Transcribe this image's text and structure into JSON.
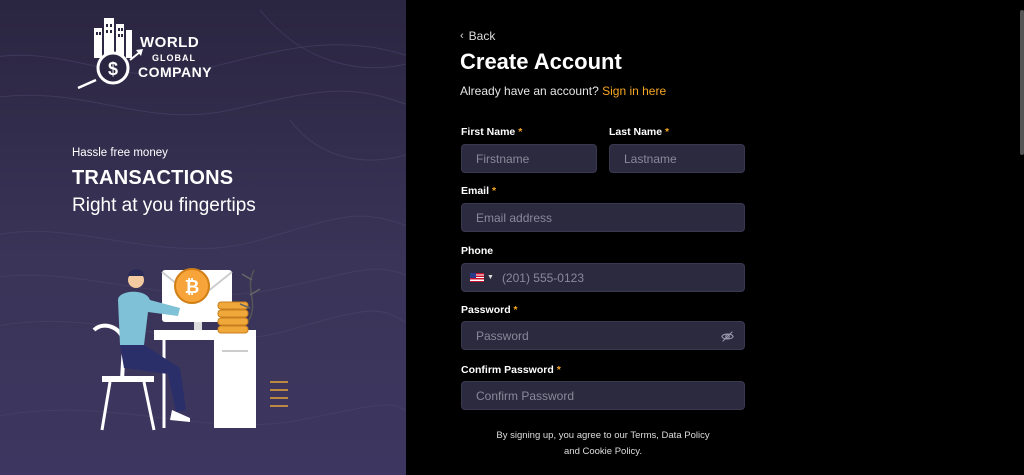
{
  "brand": {
    "line1": "WORLD",
    "line2": "GLOBAL",
    "line3": "COMPANY"
  },
  "hero": {
    "tagline_small": "Hassle free money",
    "tagline_big": "TRANSACTIONS",
    "tagline_sub": "Right at you fingertips"
  },
  "form": {
    "back_label": "Back",
    "title": "Create Account",
    "signin_prompt": "Already have an account?",
    "signin_link": "Sign in here",
    "required_mark": "*",
    "first_name": {
      "label": "First Name",
      "placeholder": "Firstname",
      "value": ""
    },
    "last_name": {
      "label": "Last Name",
      "placeholder": "Lastname",
      "value": ""
    },
    "email": {
      "label": "Email",
      "placeholder": "Email address",
      "value": ""
    },
    "phone": {
      "label": "Phone",
      "placeholder": "(201) 555-0123",
      "value": "",
      "country": "us-flag-icon"
    },
    "password": {
      "label": "Password",
      "placeholder": "Password",
      "value": ""
    },
    "confirm_password": {
      "label": "Confirm Password",
      "placeholder": "Confirm Password",
      "value": ""
    },
    "terms_line1": "By signing up, you agree to our Terms, Data Policy",
    "terms_line2": "and Cookie Policy."
  },
  "colors": {
    "accent": "#f5a623",
    "field_bg": "#2c2a3e",
    "left_bg": "#2a2540"
  }
}
